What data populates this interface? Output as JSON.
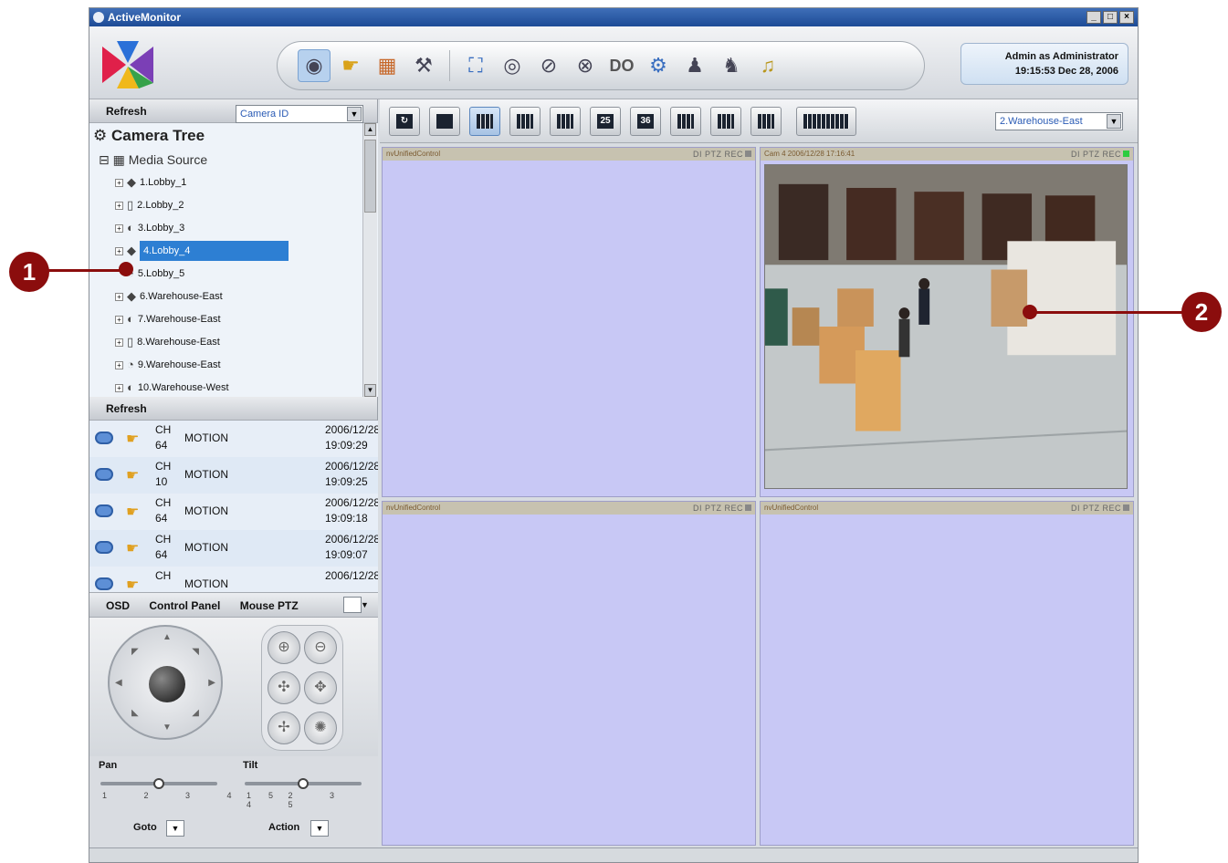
{
  "window": {
    "title": "ActiveMonitor",
    "controls": [
      "_",
      "□",
      "×"
    ]
  },
  "header": {
    "user_line": "Admin as Administrator",
    "datetime": "19:15:53 Dec 28, 2006",
    "tools": [
      "live-view-icon",
      "event-icon",
      "map-icon",
      "tools-icon",
      "fullscreen-icon",
      "snapshot-icon",
      "digital-output-icon",
      "io-icon",
      "DO",
      "settings-icon",
      "joystick-icon",
      "ptz-icon",
      "audio-icon"
    ],
    "do_label": "DO"
  },
  "left": {
    "refresh_label": "Refresh",
    "camera_select": "Camera ID",
    "tree": {
      "title": "Camera Tree",
      "source": "Media Source",
      "items": [
        {
          "label": "1.Lobby_1"
        },
        {
          "label": "2.Lobby_2"
        },
        {
          "label": "3.Lobby_3"
        },
        {
          "label": "4.Lobby_4",
          "selected": true
        },
        {
          "label": "5.Lobby_5"
        },
        {
          "label": "6.Warehouse-East"
        },
        {
          "label": "7.Warehouse-East"
        },
        {
          "label": "8.Warehouse-East"
        },
        {
          "label": "9.Warehouse-East"
        },
        {
          "label": "10.Warehouse-West"
        }
      ]
    },
    "events_refresh_label": "Refresh",
    "events": [
      {
        "ch_label": "CH",
        "ch": "64",
        "type": "MOTION",
        "date": "2006/12/28",
        "time": "19:09:29"
      },
      {
        "ch_label": "CH",
        "ch": "10",
        "type": "MOTION",
        "date": "2006/12/28",
        "time": "19:09:25"
      },
      {
        "ch_label": "CH",
        "ch": "64",
        "type": "MOTION",
        "date": "2006/12/28",
        "time": "19:09:18"
      },
      {
        "ch_label": "CH",
        "ch": "64",
        "type": "MOTION",
        "date": "2006/12/28",
        "time": "19:09:07"
      },
      {
        "ch_label": "CH",
        "ch": "",
        "type": "MOTION",
        "date": "2006/12/28",
        "time": ""
      }
    ],
    "control": {
      "tabs": [
        "OSD",
        "Control Panel",
        "Mouse PTZ"
      ],
      "pan_label": "Pan",
      "tilt_label": "Tilt",
      "pan_ticks": "1 2 3 4 5",
      "tilt_ticks": "1 2 3 4 5",
      "pan_value": 3,
      "tilt_value": 3,
      "goto_label": "Goto",
      "action_label": "Action"
    }
  },
  "main": {
    "layouts": [
      "1",
      "4",
      "9",
      "16",
      "25",
      "36"
    ],
    "layout_25": "25",
    "layout_36": "36",
    "group_select": "2.Warehouse-East",
    "cells": [
      {
        "title": "nvUnifiedControl",
        "flags": "DI PTZ REC",
        "rec_on": false,
        "has_feed": false
      },
      {
        "title": "Cam 4 2006/12/28 17:16:41",
        "flags": "DI PTZ REC",
        "rec_on": true,
        "has_feed": true
      },
      {
        "title": "nvUnifiedControl",
        "flags": "DI PTZ REC",
        "rec_on": false,
        "has_feed": false
      },
      {
        "title": "nvUnifiedControl",
        "flags": "DI PTZ REC",
        "rec_on": false,
        "has_feed": false
      }
    ]
  },
  "callouts": [
    "1",
    "2"
  ],
  "colors": {
    "title_bar": "#1d4b96",
    "selected_item": "#2d7fd3",
    "cell_bg": "#c8c8f5",
    "callout": "#8b0d0d",
    "rec_active": "#2ecc40"
  }
}
